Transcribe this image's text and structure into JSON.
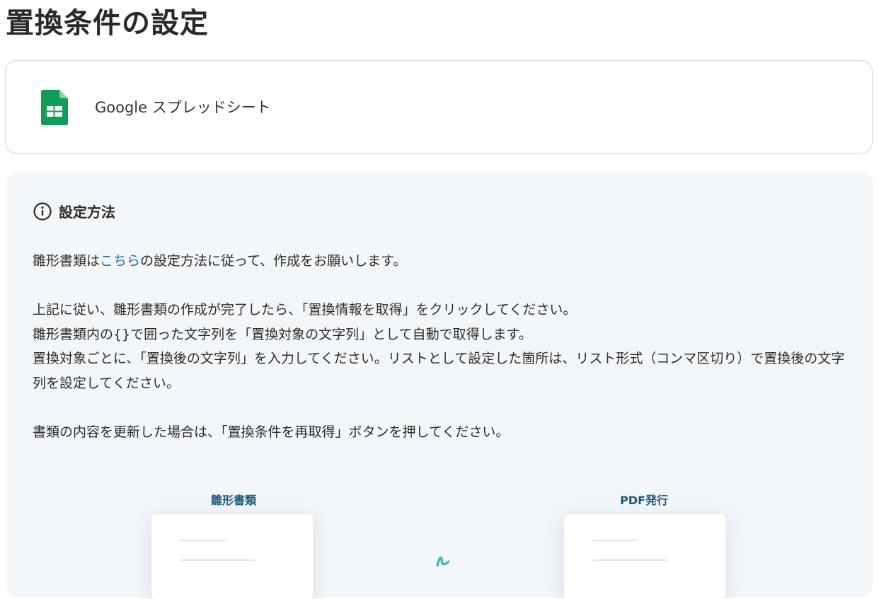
{
  "page": {
    "title": "置換条件の設定"
  },
  "app_card": {
    "app_name": "Google スプレッドシート",
    "icon": "google-sheets-icon"
  },
  "help": {
    "heading": "設定方法",
    "line1": {
      "before": "雛形書類は",
      "link": "こちら",
      "after": "の設定方法に従って、作成をお願いします。"
    },
    "line2": "上記に従い、雛形書類の作成が完了したら、「置換情報を取得」をクリックしてください。",
    "line3": "雛形書類内の{}で囲った文字列を「置換対象の文字列」として自動で取得します。",
    "line4": "置換対象ごとに、「置換後の文字列」を入力してください。リストとして設定した箇所は、リスト形式（コンマ区切り）で置換後の文字列を設定してください。",
    "line5": "書類の内容を更新した場合は、「置換条件を再取得」ボタンを押してください。"
  },
  "diagram": {
    "left_label": "雛形書類",
    "right_label": "PDF発行"
  },
  "colors": {
    "link": "#1f6f9b",
    "diagram_label": "#1e5a7e",
    "sheets_green": "#0f9d58",
    "panel_bg": "#f4f7fa"
  }
}
